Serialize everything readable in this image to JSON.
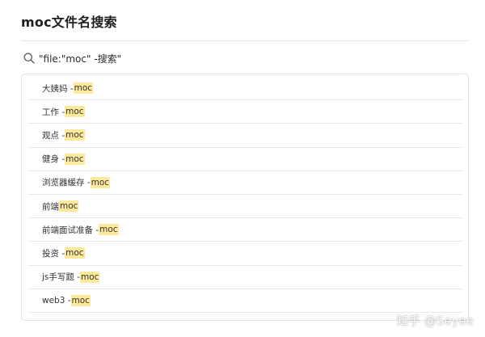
{
  "page": {
    "title": "moc文件名搜索"
  },
  "search": {
    "icon": "search-icon",
    "query": "\"file:\"moc\" -搜索\""
  },
  "results": [
    {
      "before": "大姨妈 - ",
      "match": "moc",
      "after": ""
    },
    {
      "before": "工作 - ",
      "match": "moc",
      "after": ""
    },
    {
      "before": "观点 - ",
      "match": "moc",
      "after": ""
    },
    {
      "before": "健身 - ",
      "match": "moc",
      "after": ""
    },
    {
      "before": "浏览器缓存 - ",
      "match": "moc",
      "after": ""
    },
    {
      "before": "前端 ",
      "match": "moc",
      "after": ""
    },
    {
      "before": "前端面试准备 - ",
      "match": "moc",
      "after": ""
    },
    {
      "before": "投资 - ",
      "match": "moc",
      "after": ""
    },
    {
      "before": "js手写题 - ",
      "match": "moc",
      "after": ""
    },
    {
      "before": "web3 - ",
      "match": "moc",
      "after": ""
    }
  ],
  "watermark": {
    "text": "知乎 @Seyee"
  },
  "colors": {
    "highlight": "#fde89b",
    "border": "#e2e2e2"
  }
}
